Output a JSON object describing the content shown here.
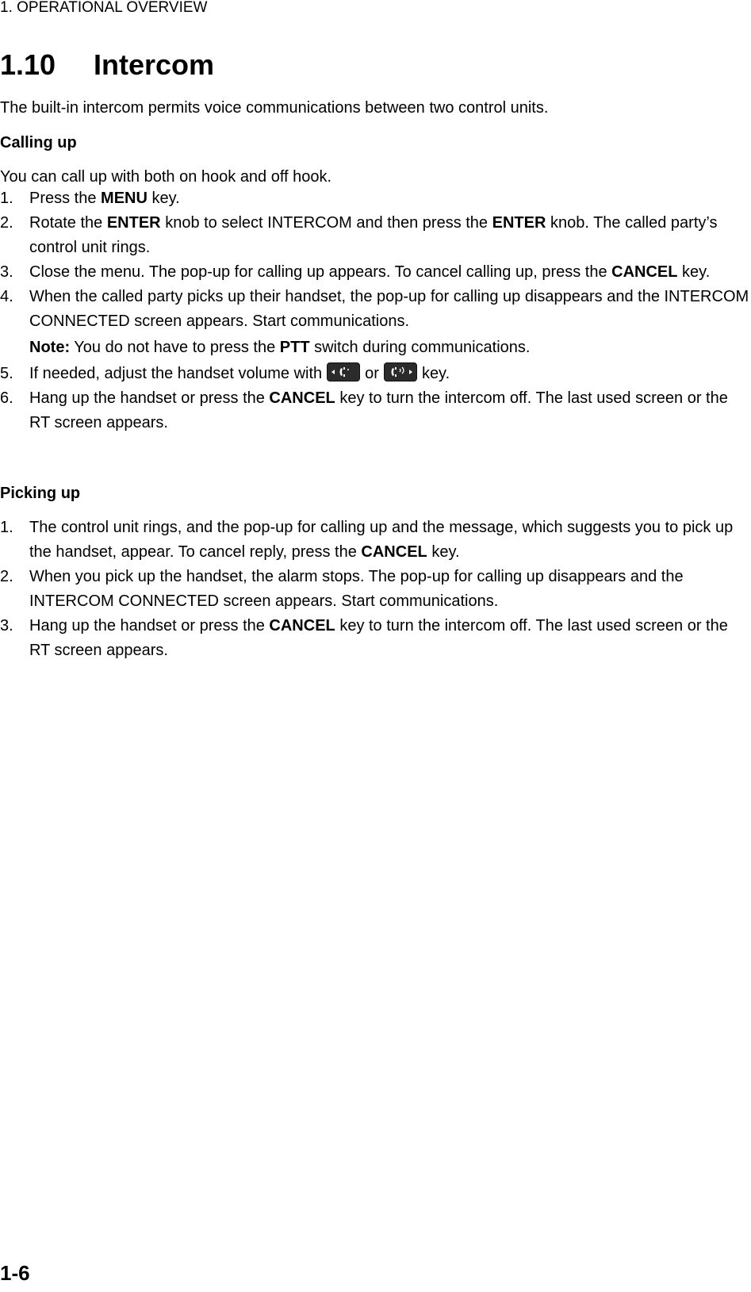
{
  "running_head": "1. OPERATIONAL OVERVIEW",
  "section": {
    "number": "1.10",
    "title": "Intercom"
  },
  "intro": "The built-in intercom permits voice communications between two control units.",
  "calling_up": {
    "heading": "Calling up",
    "lead": "You can call up with both on hook and off hook.",
    "steps": [
      {
        "n": "1.",
        "a": "Press the ",
        "b": "MENU",
        "c": " key."
      },
      {
        "n": "2.",
        "a": "Rotate the ",
        "b": "ENTER",
        "c": " knob to select INTERCOM and then press the ",
        "d": "ENTER",
        "e": " knob. The called party’s control unit rings."
      },
      {
        "n": "3.",
        "a": "Close the menu. The pop-up for calling up appears. To cancel calling up, press the ",
        "b": "CANCEL",
        "c": " key."
      },
      {
        "n": "4.",
        "a": "When the called party picks up their handset, the pop-up for calling up disappears and the INTERCOM CONNECTED screen appears. Start communications."
      }
    ],
    "note": {
      "label": "Note:",
      "a": " You do not have to press the ",
      "b": "PTT",
      "c": " switch during communications."
    },
    "steps2": [
      {
        "n": "5.",
        "a": "If needed, adjust the handset volume with",
        "or": "or",
        "c": "key.",
        "icon1": "volume-down-handset-key-icon",
        "icon2": "volume-up-handset-key-icon"
      },
      {
        "n": "6.",
        "a": "Hang up the handset or press the ",
        "b": "CANCEL",
        "c": " key to turn the intercom off. The last used screen or the RT screen appears."
      }
    ]
  },
  "picking_up": {
    "heading": "Picking up",
    "steps": [
      {
        "n": "1.",
        "a": "The control unit rings, and the pop-up for calling up and the message, which suggests you to pick up the handset, appear. To cancel reply, press the ",
        "b": "CANCEL",
        "c": " key."
      },
      {
        "n": "2.",
        "a": "When you pick up the handset, the alarm stops. The pop-up for calling up disappears and the INTERCOM CONNECTED screen appears. Start communications."
      },
      {
        "n": "3.",
        "a": "Hang up the handset or press the ",
        "b": "CANCEL",
        "c": " key to turn the intercom off. The last used screen or the RT screen appears."
      }
    ]
  },
  "page_number": "1-6"
}
